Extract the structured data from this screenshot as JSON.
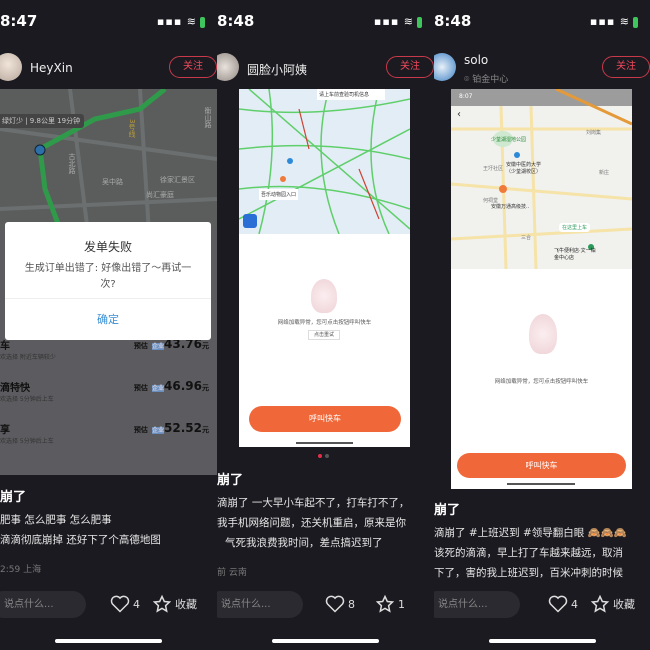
{
  "posts": [
    {
      "time": "8:47",
      "user": "HeyXin",
      "follow": "关注",
      "shot": {
        "route_info": "绿灯少 | 9.8公里 19分钟",
        "roads": [
          "吴中路",
          "古北路",
          "徐家汇景区",
          "尚汇豪庭",
          "衡山路",
          "3号线"
        ],
        "dialog": {
          "title": "发单失败",
          "message": "生成订单出错了: 好像出错了～再试一次?",
          "confirm": "确定"
        },
        "rides": [
          {
            "name": "车",
            "sub": "欢选择  附近车辆较少",
            "est": "预估",
            "tag": "企业",
            "price": "43.76",
            "unit": "元"
          },
          {
            "name": "滴特快",
            "sub": "欢选择  5分钟后上车",
            "est": "预估",
            "tag": "企业",
            "price": "46.96",
            "unit": "元"
          },
          {
            "name": "享",
            "sub": "欢选择  5分钟后上车",
            "est": "预估",
            "tag": "企业",
            "price": "52.52",
            "unit": "元"
          }
        ]
      },
      "title": "崩了",
      "lines": [
        "肥事 怎么肥事 怎么肥事",
        "滴滴彻底崩掉 还好下了个高德地图"
      ],
      "meta": "2:59 上海",
      "comment_placeholder": "说点什么...",
      "likes": "4",
      "fav": "收藏"
    },
    {
      "time": "8:48",
      "user": "圆脸小阿姨",
      "follow": "关注",
      "shot": {
        "callout": "请上车前查验司机信息",
        "place": "吾乐动物园入口",
        "error": "网络加载异常，您可点击按钮呼叫快车",
        "retry": "点击重试",
        "call": "呼叫快车"
      },
      "title": "崩了",
      "lines": [
        "滴崩了  一大早小车起不了，打车打不了，",
        "我手机网络问题，还关机重启，原来是你",
        "气死我浪费我时间，差点搞迟到了"
      ],
      "meta": "前 云南",
      "comment_placeholder": "说点什么...",
      "likes": "8",
      "fav": "1"
    },
    {
      "time": "8:48",
      "user": "solo",
      "location": "铂金中心",
      "follow": "关注",
      "shot": {
        "status_time": "8:07",
        "places": [
          "少荃湖湿地公园",
          "安徽中医药大学（少荃湖校区）",
          "王圩社区",
          "刘岗集",
          "新庄",
          "安徽万通高级技..",
          "三合",
          "何祠堂"
        ],
        "pickup": "在这里上车",
        "pickup_place": "飞牛便利店·文一铂金中心店",
        "error": "网络加载异常，您可点击按钮呼叫快车",
        "call": "呼叫快车"
      },
      "title": "崩了",
      "lines": [
        "滴崩了 #上班迟到  #领导翻白眼 🙈🙈🙈",
        "该死的滴滴，早上打了车越来越远，取消",
        "下了，害的我上班迟到，百米冲刺的时候"
      ],
      "meta": "",
      "comment_placeholder": "说点什么...",
      "likes": "4",
      "fav": "收藏"
    }
  ],
  "colors": {
    "bg": "#1b1a20",
    "follow": "#f04a5c",
    "didi_orange": "#f0683a",
    "confirm_blue": "#3a8fd6"
  }
}
